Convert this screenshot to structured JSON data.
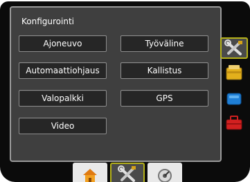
{
  "panel": {
    "title": "Konfigurointi"
  },
  "buttons": {
    "ajoneuvo": "Ajoneuvo",
    "tyovaline": "Työväline",
    "automaattiohjaus": "Automaattiohjaus",
    "kallistus": "Kallistus",
    "valopalkki": "Valopalkki",
    "gps": "GPS",
    "video": "Video"
  },
  "side_tabs": [
    {
      "icon": "wrench-screwdriver-icon",
      "active": true
    },
    {
      "icon": "yellow-folder-icon",
      "active": false
    },
    {
      "icon": "blue-screen-icon",
      "active": false
    },
    {
      "icon": "red-toolbox-icon",
      "active": false
    }
  ],
  "bottom_tabs": [
    {
      "icon": "home-icon",
      "active": false
    },
    {
      "icon": "wrench-screwdriver-icon",
      "active": true
    },
    {
      "icon": "gauge-icon",
      "active": false
    }
  ],
  "colors": {
    "accent_border": "#b6b21a",
    "panel_bg": "#3f3f3f",
    "button_bg": "#262626"
  }
}
